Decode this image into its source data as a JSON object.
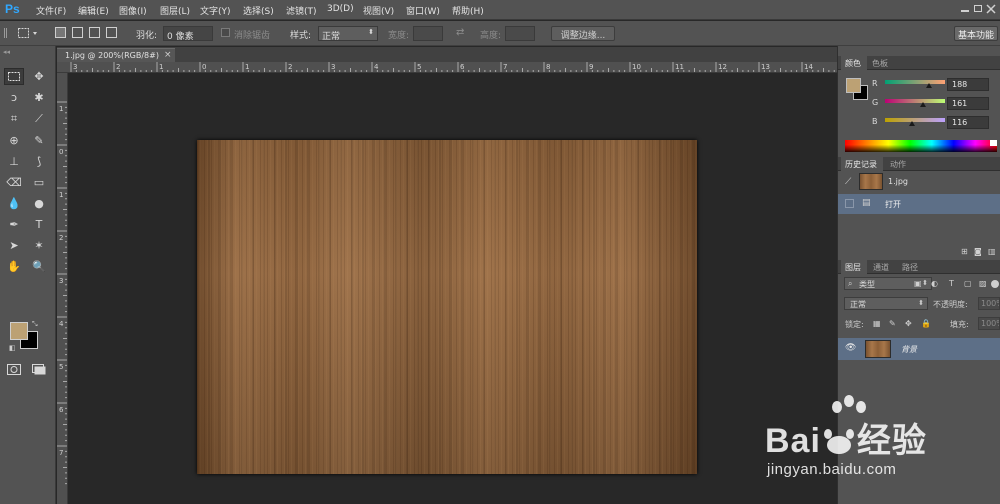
{
  "app": {
    "logo": "Ps"
  },
  "menu": [
    "文件(F)",
    "编辑(E)",
    "图像(I)",
    "图层(L)",
    "文字(Y)",
    "选择(S)",
    "滤镜(T)",
    "3D(D)",
    "视图(V)",
    "窗口(W)",
    "帮助(H)"
  ],
  "options": {
    "feather_label": "羽化:",
    "feather_value": "0 像素",
    "antialias_label": "消除锯齿",
    "style_label": "样式:",
    "style_value": "正常",
    "width_label": "宽度:",
    "height_label": "高度:",
    "refine_edge": "调整边缘...",
    "workspace": "基本功能"
  },
  "document": {
    "tab_title": "1.jpg @ 200%(RGB/8#)",
    "close": "×"
  },
  "ruler_h": [
    "3",
    "2",
    "1",
    "0",
    "1",
    "2",
    "3",
    "4",
    "5",
    "6",
    "7",
    "8",
    "9",
    "10",
    "11",
    "12",
    "13",
    "14"
  ],
  "ruler_v": [
    "1",
    "0",
    "1",
    "2",
    "3",
    "4",
    "5",
    "6",
    "7"
  ],
  "color_panel": {
    "tabs": [
      "颜色",
      "色板"
    ],
    "foreground": "#bca174",
    "background": "#000000",
    "r_label": "R",
    "r_value": "188",
    "r": 188,
    "g_label": "G",
    "g_value": "161",
    "g": 161,
    "b_label": "B",
    "b_value": "116",
    "b": 116
  },
  "history_panel": {
    "tabs": [
      "历史记录",
      "动作"
    ],
    "snapshot_name": "1.jpg",
    "steps": [
      "打开"
    ]
  },
  "layers_panel": {
    "tabs": [
      "图层",
      "通道",
      "路径"
    ],
    "filter_type": "类型",
    "blend_mode": "正常",
    "opacity_label": "不透明度:",
    "opacity_value": "100%",
    "lock_label": "锁定:",
    "fill_label": "填充:",
    "fill_value": "100%",
    "layers": [
      {
        "name": "背景"
      }
    ]
  },
  "watermark": {
    "brand": "Bai",
    "brand_suffix": "经验",
    "url": "jingyan.baidu.com"
  }
}
